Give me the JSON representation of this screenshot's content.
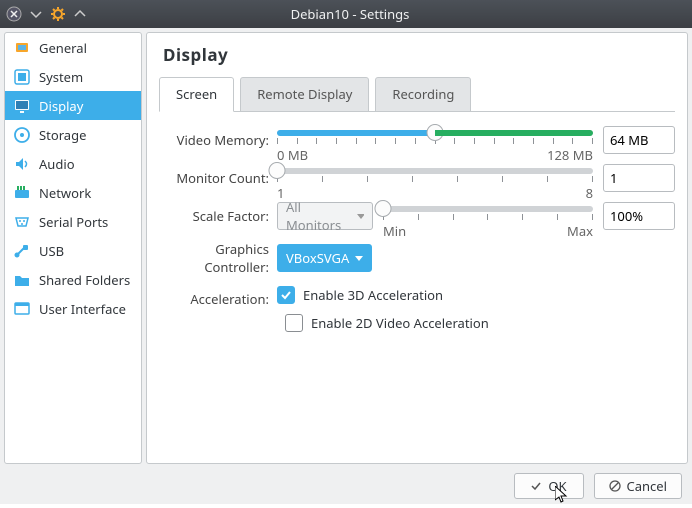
{
  "window": {
    "title": "Debian10 - Settings"
  },
  "sidebar": {
    "items": [
      {
        "label": "General"
      },
      {
        "label": "System"
      },
      {
        "label": "Display"
      },
      {
        "label": "Storage"
      },
      {
        "label": "Audio"
      },
      {
        "label": "Network"
      },
      {
        "label": "Serial Ports"
      },
      {
        "label": "USB"
      },
      {
        "label": "Shared Folders"
      },
      {
        "label": "User Interface"
      }
    ]
  },
  "page": {
    "title": "Display",
    "tabs": {
      "screen": "Screen",
      "remote": "Remote Display",
      "recording": "Recording"
    },
    "video_memory": {
      "label": "Video Memory:",
      "min": "0 MB",
      "max": "128 MB",
      "value": "64 MB"
    },
    "monitor_count": {
      "label": "Monitor Count:",
      "min": "1",
      "max": "8",
      "value": "1"
    },
    "scale_factor": {
      "label": "Scale Factor:",
      "target": "All Monitors",
      "min": "Min",
      "max": "Max",
      "value": "100%"
    },
    "graphics_controller": {
      "label": "Graphics Controller:",
      "value": "VBoxSVGA"
    },
    "acceleration": {
      "label": "Acceleration:",
      "opt_3d": "Enable 3D Acceleration",
      "opt_2d": "Enable 2D Video Acceleration",
      "checked_3d": true,
      "checked_2d": false
    }
  },
  "buttons": {
    "ok": "OK",
    "cancel": "Cancel"
  }
}
